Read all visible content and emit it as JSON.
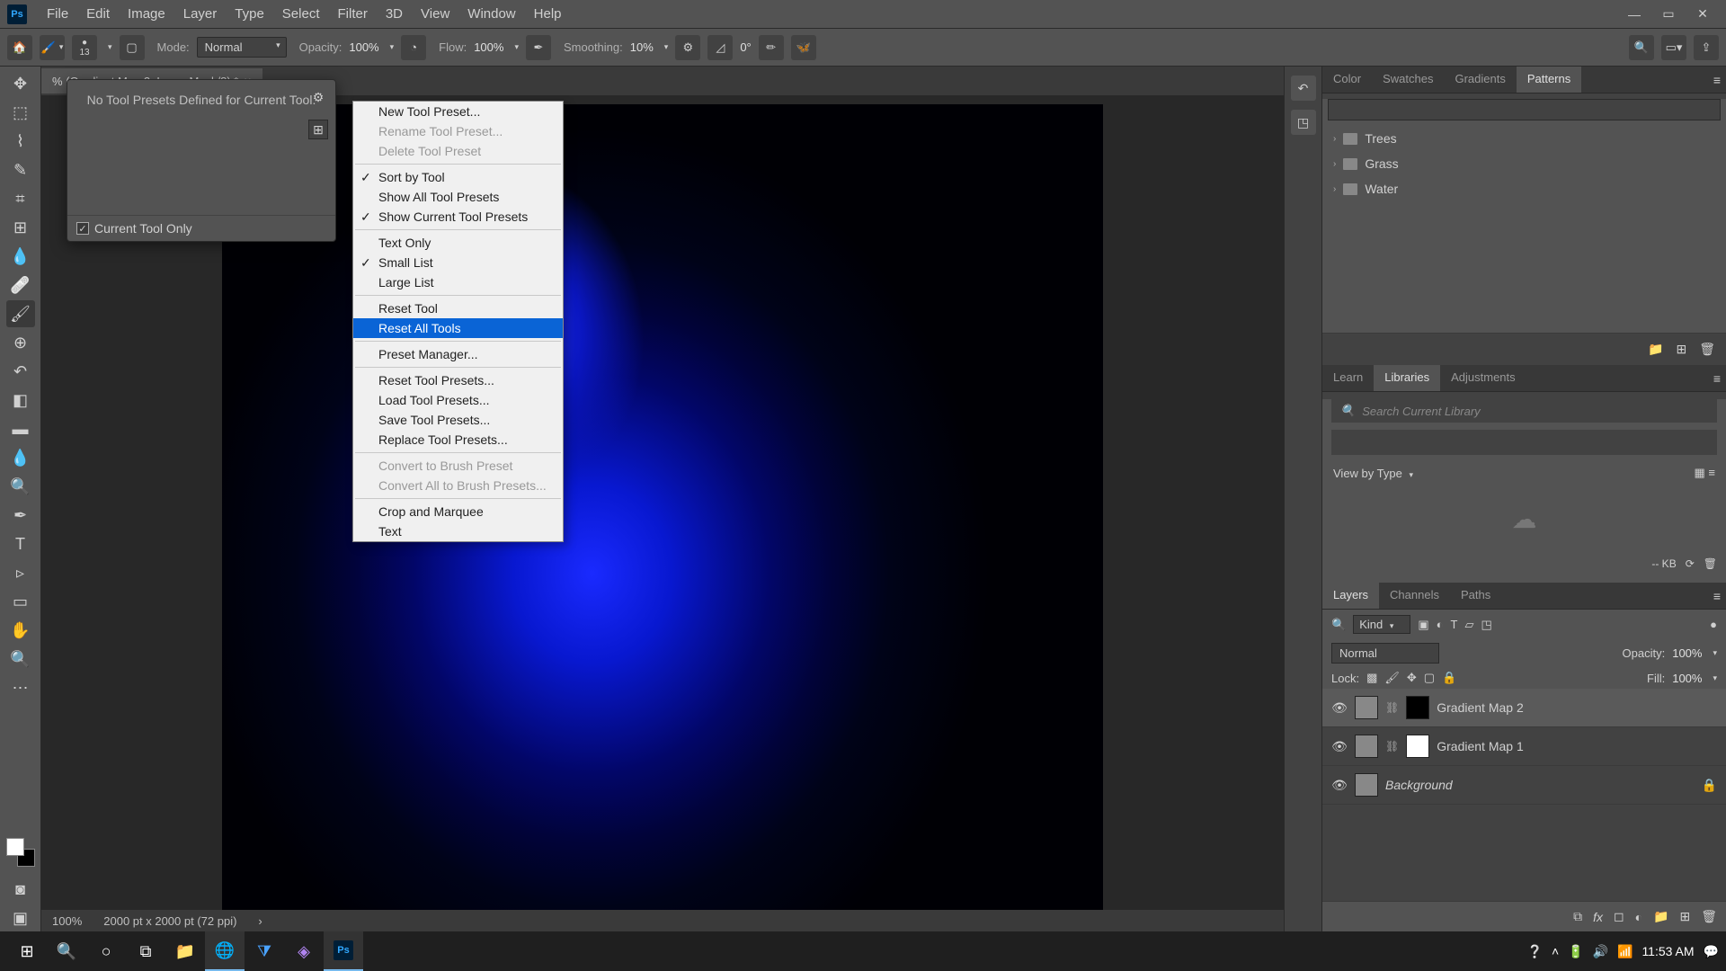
{
  "menubar": [
    "File",
    "Edit",
    "Image",
    "Layer",
    "Type",
    "Select",
    "Filter",
    "3D",
    "View",
    "Window",
    "Help"
  ],
  "optionsbar": {
    "brush_size": "13",
    "mode_label": "Mode:",
    "mode_value": "Normal",
    "opacity_label": "Opacity:",
    "opacity_value": "100%",
    "flow_label": "Flow:",
    "flow_value": "100%",
    "smoothing_label": "Smoothing:",
    "smoothing_value": "10%",
    "angle_value": "0°"
  },
  "doc_tab": {
    "label": "% (Gradient Map 2, Layer Mask/8) *"
  },
  "preset_popup": {
    "empty_text": "No Tool Presets Defined for Current Tool.",
    "current_only_label": "Current Tool Only"
  },
  "context_menu": [
    {
      "type": "item",
      "label": "New Tool Preset..."
    },
    {
      "type": "item",
      "label": "Rename Tool Preset...",
      "disabled": true
    },
    {
      "type": "item",
      "label": "Delete Tool Preset",
      "disabled": true
    },
    {
      "type": "sep"
    },
    {
      "type": "item",
      "label": "Sort by Tool",
      "checked": true
    },
    {
      "type": "item",
      "label": "Show All Tool Presets"
    },
    {
      "type": "item",
      "label": "Show Current Tool Presets",
      "checked": true
    },
    {
      "type": "sep"
    },
    {
      "type": "item",
      "label": "Text Only"
    },
    {
      "type": "item",
      "label": "Small List",
      "checked": true
    },
    {
      "type": "item",
      "label": "Large List"
    },
    {
      "type": "sep"
    },
    {
      "type": "item",
      "label": "Reset Tool"
    },
    {
      "type": "item",
      "label": "Reset All Tools",
      "highlighted": true
    },
    {
      "type": "sep"
    },
    {
      "type": "item",
      "label": "Preset Manager..."
    },
    {
      "type": "sep"
    },
    {
      "type": "item",
      "label": "Reset Tool Presets..."
    },
    {
      "type": "item",
      "label": "Load Tool Presets..."
    },
    {
      "type": "item",
      "label": "Save Tool Presets..."
    },
    {
      "type": "item",
      "label": "Replace Tool Presets..."
    },
    {
      "type": "sep"
    },
    {
      "type": "item",
      "label": "Convert to Brush Preset",
      "disabled": true
    },
    {
      "type": "item",
      "label": "Convert All to Brush Presets...",
      "disabled": true
    },
    {
      "type": "sep"
    },
    {
      "type": "item",
      "label": "Crop and Marquee"
    },
    {
      "type": "item",
      "label": "Text"
    }
  ],
  "statusbar": {
    "zoom": "100%",
    "dimensions": "2000 pt x 2000 pt (72 ppi)"
  },
  "panels": {
    "group1_tabs": [
      "Color",
      "Swatches",
      "Gradients",
      "Patterns"
    ],
    "group1_active": "Patterns",
    "patterns_folders": [
      "Trees",
      "Grass",
      "Water"
    ],
    "group2_tabs": [
      "Learn",
      "Libraries",
      "Adjustments"
    ],
    "group2_active": "Libraries",
    "lib_search_placeholder": "Search Current Library",
    "lib_viewby": "View by Type",
    "lib_kb": "-- KB",
    "group3_tabs": [
      "Layers",
      "Channels",
      "Paths"
    ],
    "group3_active": "Layers",
    "layer_filter_kind": "Kind",
    "layer_blend_mode": "Normal",
    "layer_opacity_label": "Opacity:",
    "layer_opacity_value": "100%",
    "layer_lock_label": "Lock:",
    "layer_fill_label": "Fill:",
    "layer_fill_value": "100%",
    "layers": [
      {
        "name": "Gradient Map 2",
        "selected": true,
        "mask": "black",
        "italic": false,
        "locked": false,
        "link": true
      },
      {
        "name": "Gradient Map 1",
        "selected": false,
        "mask": "white",
        "italic": false,
        "locked": false,
        "link": true
      },
      {
        "name": "Background",
        "selected": false,
        "mask": null,
        "italic": true,
        "locked": true,
        "link": false
      }
    ]
  },
  "taskbar": {
    "time": "11:53 AM"
  }
}
